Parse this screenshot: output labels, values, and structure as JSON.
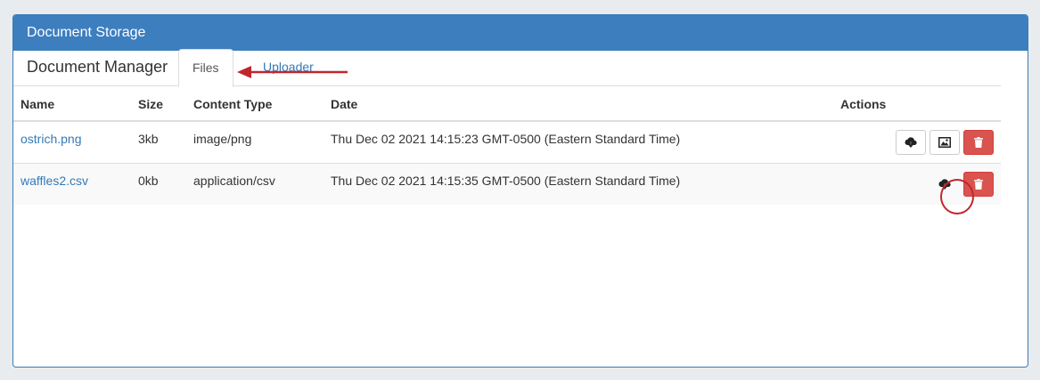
{
  "panel": {
    "title": "Document Storage"
  },
  "tabs": {
    "title": "Document Manager",
    "items": [
      {
        "label": "Files",
        "active": true
      },
      {
        "label": "Uploader",
        "active": false
      }
    ]
  },
  "table": {
    "headers": [
      "Name",
      "Size",
      "Content Type",
      "Date",
      "Actions"
    ],
    "rows": [
      {
        "name": "ostrich.png",
        "size": "3kb",
        "content_type": "image/png",
        "date": "Thu Dec 02 2021 14:15:23 GMT-0500 (Eastern Standard Time)",
        "actions": [
          "cloud-download-icon",
          "image-icon",
          "trash-icon"
        ]
      },
      {
        "name": "waffles2.csv",
        "size": "0kb",
        "content_type": "application/csv",
        "date": "Thu Dec 02 2021 14:15:35 GMT-0500 (Eastern Standard Time)",
        "actions": [
          "cloud-download-icon",
          "trash-icon"
        ]
      }
    ]
  },
  "colors": {
    "header_bg": "#3d7ebf",
    "link": "#337ab7",
    "danger": "#d9534f",
    "annotation": "#c0262d"
  }
}
